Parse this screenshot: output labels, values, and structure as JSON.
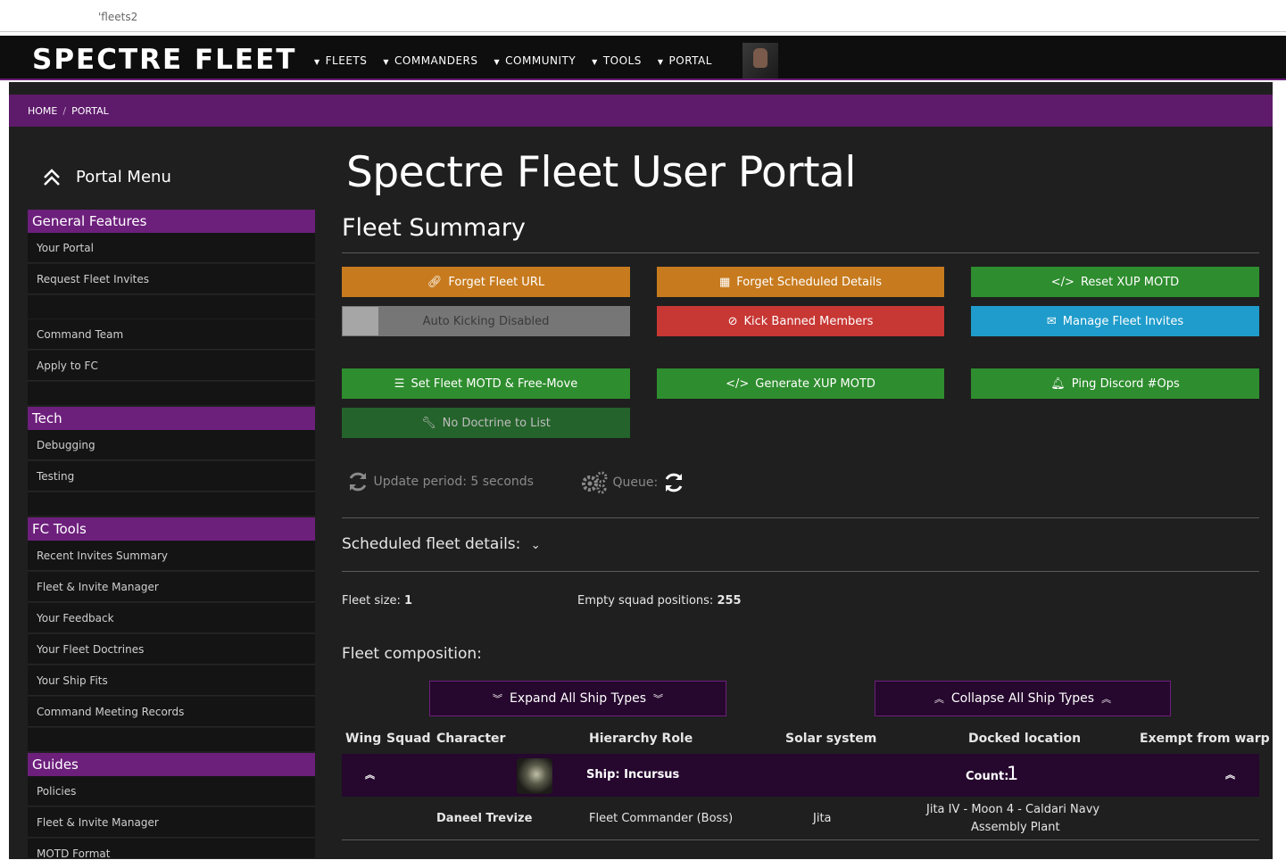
{
  "browser": {
    "url": "'fleets2"
  },
  "nav": {
    "logo": "SPECTRE FLEET",
    "items": [
      {
        "label": "FLEETS"
      },
      {
        "label": "COMMANDERS"
      },
      {
        "label": "COMMUNITY"
      },
      {
        "label": "TOOLS"
      },
      {
        "label": "PORTAL"
      }
    ]
  },
  "breadcrumb": {
    "home": "HOME",
    "sep": "/",
    "current": "PORTAL"
  },
  "sidebar": {
    "title": "Portal Menu",
    "sections": [
      {
        "heading": "General Features",
        "items": [
          "Your Portal",
          "Request Fleet Invites",
          "Command Team",
          "Apply to FC"
        ]
      },
      {
        "heading": "Tech",
        "items": [
          "Debugging",
          "Testing"
        ]
      },
      {
        "heading": "FC Tools",
        "items": [
          "Recent Invites Summary",
          "Fleet & Invite Manager",
          "Your Feedback",
          "Your Fleet Doctrines",
          "Your Ship Fits",
          "Command Meeting Records"
        ]
      },
      {
        "heading": "Guides",
        "items": [
          "Policies",
          "Fleet & Invite Manager",
          "MOTD Format"
        ]
      }
    ]
  },
  "main": {
    "title": "Spectre Fleet User Portal",
    "subtitle": "Fleet Summary",
    "buttons": {
      "forget_url": "Forget Fleet URL",
      "forget_sched": "Forget Scheduled Details",
      "reset_xup": "Reset XUP MOTD",
      "auto_kick": "Auto Kicking Disabled",
      "kick_banned": "Kick Banned Members",
      "manage_invites": "Manage Fleet Invites",
      "set_motd": "Set Fleet MOTD & Free-Move",
      "gen_xup": "Generate XUP MOTD",
      "ping_discord": "Ping Discord #Ops",
      "no_doctrine": "No Doctrine to List"
    },
    "update_period": "Update period: 5 seconds",
    "queue_label": "Queue:",
    "scheduled_label": "Scheduled fleet details:",
    "fleet_size_label": "Fleet size:",
    "fleet_size_value": "1",
    "empty_squad_label": "Empty squad positions:",
    "empty_squad_value": "255",
    "composition_label": "Fleet composition:",
    "expand_label": "Expand All Ship Types",
    "collapse_label": "Collapse All Ship Types",
    "table": {
      "headers": [
        "Wing",
        "Squad",
        "Character",
        "Hierarchy Role",
        "Solar system",
        "Docked location",
        "Exempt from warp"
      ],
      "ship_label": "Ship: Incursus",
      "count_label": "Count:",
      "count_value": "1",
      "rows": [
        {
          "character": "Daneel Trevize",
          "role": "Fleet Commander (Boss)",
          "system": "Jita",
          "docked_line1": "Jita IV - Moon 4 - Caldari Navy",
          "docked_line2": "Assembly Plant"
        }
      ]
    }
  },
  "colors": {
    "accent": "#6d1f7c",
    "orange": "#c77b1e",
    "red": "#c73734",
    "green": "#2e8d2e",
    "blue": "#1f9ccb"
  }
}
